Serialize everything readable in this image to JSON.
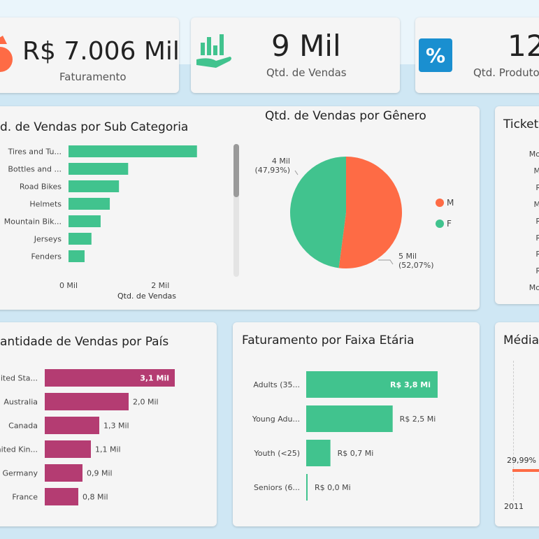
{
  "kpis": [
    {
      "value": "R$ 7.006 Mil",
      "label": "Faturamento",
      "icon": "money-bag-icon"
    },
    {
      "value": "9 Mil",
      "label": "Qtd. de Vendas",
      "icon": "sales-hand-chart-icon"
    },
    {
      "value": "12",
      "label": "Qtd. Produtos",
      "icon": "percent-icon"
    }
  ],
  "colors": {
    "bar_green": "#41c38e",
    "bar_pink": "#b43c72",
    "pie_orange": "#fe6b45",
    "pie_green": "#41c38e",
    "icon_blue": "#1a8fd0"
  },
  "panels": {
    "subcat": {
      "title": "d. de Vendas por Sub Categoria"
    },
    "gender": {
      "title": "Qtd. de Vendas por Gênero"
    },
    "ticket": {
      "title": "Ticket",
      "labels": [
        "Mounta",
        "Mount",
        "Road-",
        "Mount",
        "Road-",
        "Road-",
        "Road-",
        "Road-",
        "Mounta"
      ]
    },
    "pais": {
      "title": "antidade de Vendas por País"
    },
    "faixa": {
      "title": "Faturamento por Faixa Etária"
    },
    "media": {
      "title": "Média",
      "label": "29,99%",
      "x_label": "2011"
    }
  },
  "chart_data": [
    {
      "type": "bar",
      "orientation": "horizontal",
      "title": "d. de Vendas por Sub Categoria",
      "categories": [
        "Tires and Tu...",
        "Bottles and ...",
        "Road Bikes",
        "Helmets",
        "Mountain Bik...",
        "Jerseys",
        "Fenders"
      ],
      "values": [
        2.8,
        1.3,
        1.1,
        0.9,
        0.7,
        0.5,
        0.35
      ],
      "xlabel": "Qtd. de Vendas",
      "xticks": [
        "0 Mil",
        "2 Mil"
      ],
      "xlim": [
        0,
        3.2
      ]
    },
    {
      "type": "pie",
      "title": "Qtd. de Vendas por Gênero",
      "categories": [
        "M",
        "F"
      ],
      "values": [
        52.07,
        47.93
      ],
      "labels": [
        {
          "value": "5 Mil",
          "pct": "(52,07%)"
        },
        {
          "value": "4 Mil",
          "pct": "(47,93%)"
        }
      ],
      "legend": "right"
    },
    {
      "type": "bar",
      "orientation": "horizontal",
      "title": "antidade de Vendas por País",
      "categories": [
        "nited Sta...",
        "Australia",
        "Canada",
        "nited Kin...",
        "Germany",
        "France"
      ],
      "values": [
        3.1,
        2.0,
        1.3,
        1.1,
        0.9,
        0.8
      ],
      "data_labels": [
        "3,1 Mil",
        "2,0 Mil",
        "1,3 Mil",
        "1,1 Mil",
        "0,9 Mil",
        "0,8 Mil"
      ]
    },
    {
      "type": "bar",
      "orientation": "horizontal",
      "title": "Faturamento por Faixa Etária",
      "categories": [
        "Adults (35...",
        "Young Adu...",
        "Youth (<25)",
        "Seniors (6..."
      ],
      "values": [
        3.8,
        2.5,
        0.7,
        0.02
      ],
      "data_labels": [
        "R$ 3,8 Mi",
        "R$ 2,5 Mi",
        "R$ 0,7 Mi",
        "R$ 0,0 Mi"
      ]
    }
  ]
}
